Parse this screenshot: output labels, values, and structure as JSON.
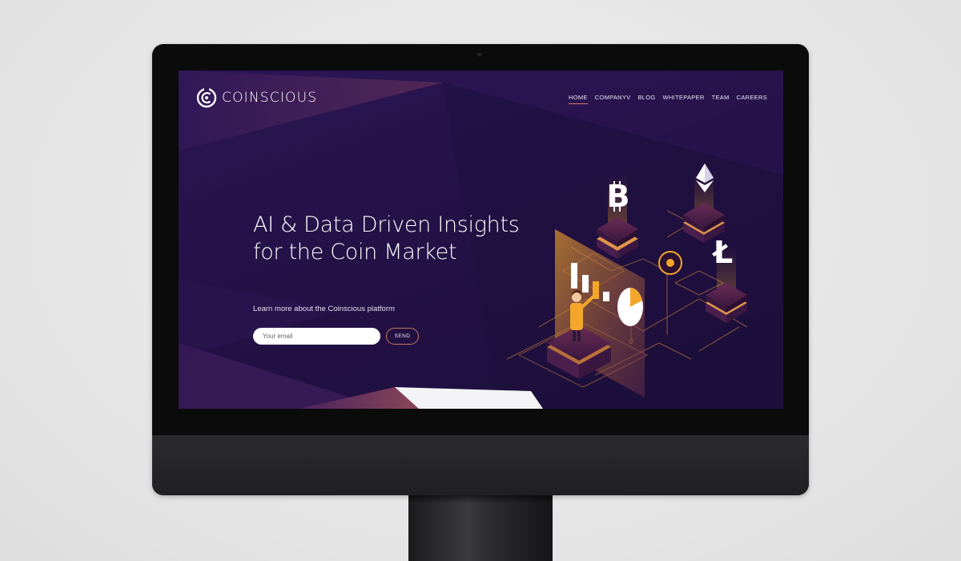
{
  "brand": {
    "name": "COINSCIOUS",
    "logo_icon": "coinscious-logo-icon"
  },
  "nav": {
    "items": [
      {
        "label": "HOME",
        "active": true
      },
      {
        "label": "COMPANYV",
        "active": false
      },
      {
        "label": "BLOG",
        "active": false
      },
      {
        "label": "WHITEPAPER",
        "active": false
      },
      {
        "label": "TEAM",
        "active": false
      },
      {
        "label": "CAREERS",
        "active": false
      }
    ]
  },
  "hero": {
    "title_line1": "AI & Data Driven Insights",
    "title_line2": "for the Coin Market",
    "subtitle": "Learn more about the Coinscious platform",
    "email_placeholder": "Your email",
    "send_label": "SEND"
  },
  "illustration": {
    "icons": [
      "bitcoin-icon",
      "ethereum-icon",
      "litecoin-icon",
      "bar-chart-icon",
      "pie-chart-icon",
      "person-figure-icon"
    ]
  },
  "colors": {
    "background_dark": "#1d0f3c",
    "background_purple": "#2b1654",
    "accent_orange": "#f4a62a",
    "accent_coral": "#e07a5f",
    "platform_maroon": "#4a1f4e"
  }
}
